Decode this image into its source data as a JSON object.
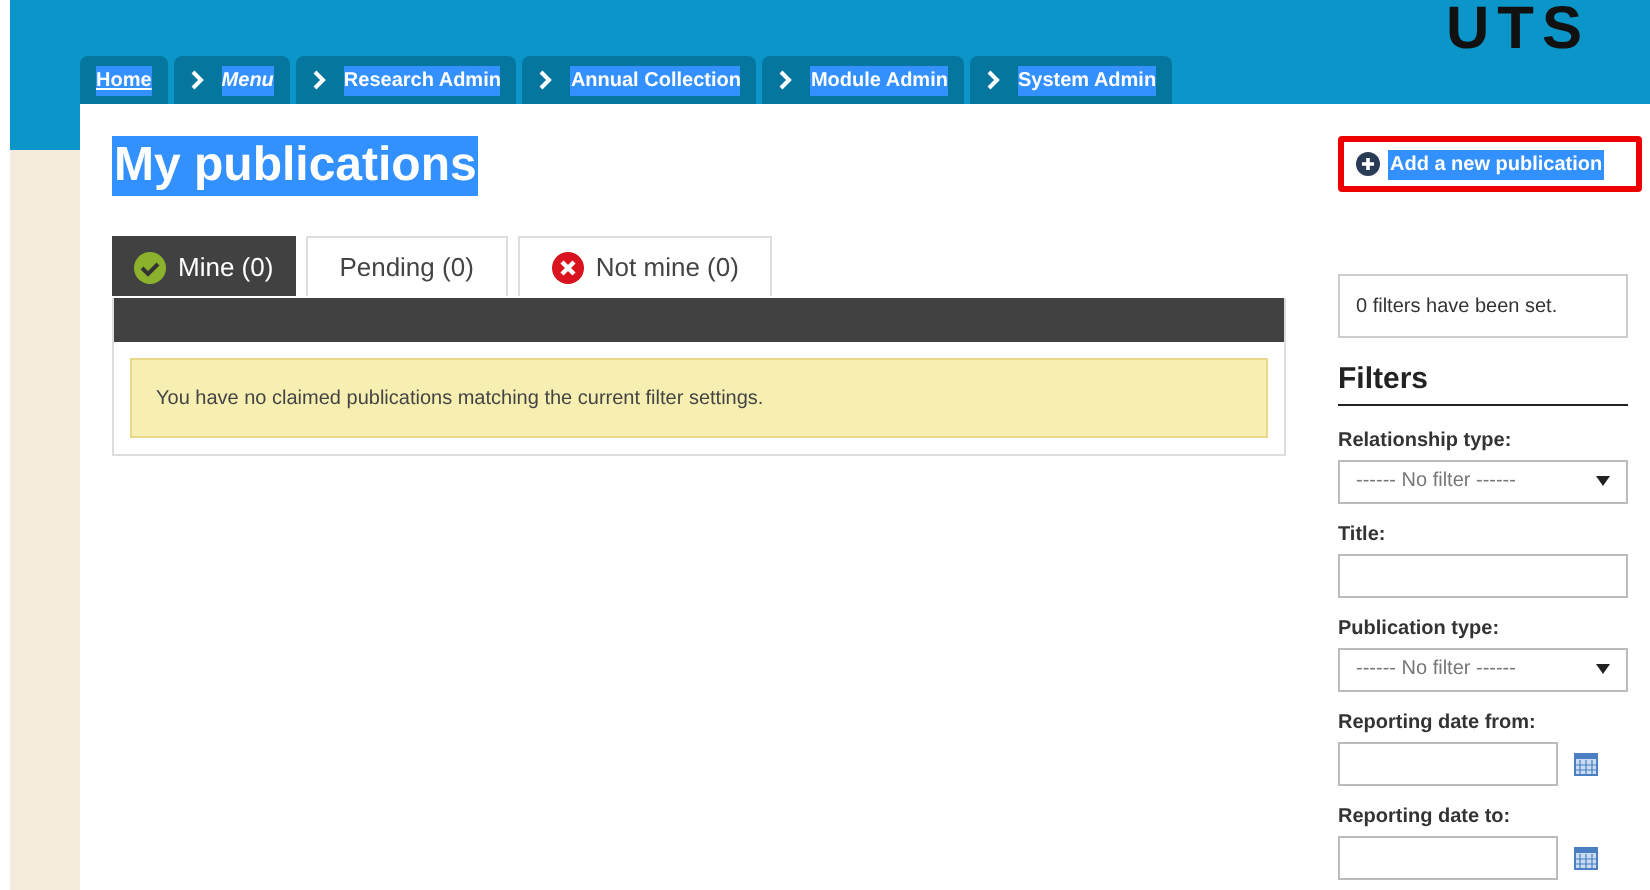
{
  "logo": {
    "text": "UTS"
  },
  "nav": [
    {
      "label": "Home",
      "kind": "home"
    },
    {
      "label": "Menu",
      "kind": "menu"
    },
    {
      "label": "Research Admin",
      "kind": "link"
    },
    {
      "label": "Annual Collection",
      "kind": "link"
    },
    {
      "label": "Module Admin",
      "kind": "link"
    },
    {
      "label": "System Admin",
      "kind": "link"
    }
  ],
  "page_title": "My publications",
  "add_button": {
    "label": "Add a new publication",
    "highlighted": true
  },
  "tabs": [
    {
      "label": "Mine (0)",
      "selected": true,
      "kind": "check"
    },
    {
      "label": "Pending (0)",
      "selected": false,
      "kind": "plain"
    },
    {
      "label": "Not mine (0)",
      "selected": false,
      "kind": "cross"
    }
  ],
  "notice": "You have no claimed publications matching the current filter settings.",
  "filters_status": "0 filters have been set.",
  "filters": {
    "title": "Filters",
    "fields": [
      {
        "label": "Relationship type:",
        "kind": "select",
        "value": "------ No filter ------"
      },
      {
        "label": "Title:",
        "kind": "text"
      },
      {
        "label": "Publication type:",
        "kind": "select",
        "value": "------ No filter ------"
      },
      {
        "label": "Reporting date from:",
        "kind": "date"
      },
      {
        "label": "Reporting date to:",
        "kind": "date"
      }
    ]
  }
}
